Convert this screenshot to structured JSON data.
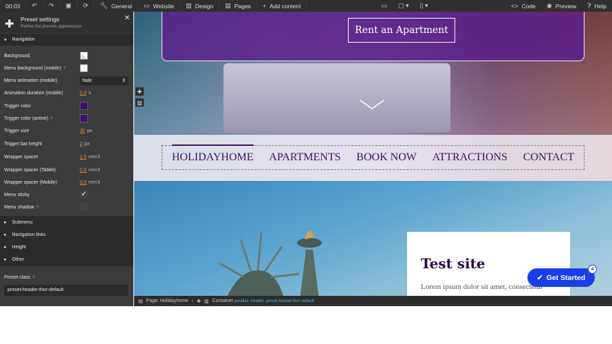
{
  "toolbar": {
    "time": "00:03",
    "general": "General",
    "website": "Website",
    "design": "Design",
    "pages": "Pages",
    "add_content": "Add content",
    "code": "Code",
    "preview": "Preview",
    "help": "Help"
  },
  "panel": {
    "title": "Preset settings",
    "subtitle": "Refine the presets appearance",
    "section": "Navigation",
    "rows": {
      "background": "Background",
      "menu_bg_mobile": "Menu background (mobile)",
      "menu_anim_mobile": "Menu animation (mobile)",
      "menu_anim_value": "fade",
      "anim_duration": "Animation duration (mobile)",
      "anim_duration_value": "0.3",
      "anim_duration_unit": "s",
      "trigger_color": "Trigger color",
      "trigger_color_value": "#3d0e6e",
      "trigger_color_active": "Trigger color (active)",
      "trigger_size": "Trigger size",
      "trigger_size_value": "30",
      "px": "px",
      "trigger_bar_height": "Trigger bar height",
      "trigger_bar_height_value": "2",
      "wrapper_spacer": "Wrapper spacer",
      "wrapper_spacer_value": "1.5",
      "rem": "rem",
      "wrapper_spacer_tablet": "Wrapper spacer (Tablet)",
      "wrapper_spacer_tablet_value": "0.5",
      "wrapper_spacer_mobile": "Wrapper spacer (Mobile)",
      "wrapper_spacer_mobile_value": "0.5",
      "menu_sticky": "Menu sticky",
      "menu_sticky_checked": true,
      "menu_shadow": "Menu shadow",
      "menu_shadow_checked": false
    },
    "collapsed": [
      "Submenu",
      "Navigation links",
      "Height",
      "Other"
    ],
    "preset_class_label": "Preset class",
    "preset_class_value": "preset-header-thor-default"
  },
  "site": {
    "cta": "Rent an Apartment",
    "nav": [
      "HOLIDAYHOME",
      "APARTMENTS",
      "BOOK NOW",
      "ATTRACTIONS",
      "CONTACT"
    ],
    "card_title": "Test site",
    "card_text": "Lorem ipsum dolor sit amet, consectetur",
    "get_started": "Get Started",
    "badge": "4"
  },
  "status": {
    "page": "Page: Holidayhome",
    "container": "Container",
    "classes": ".parallax .header .preset-header-thor-default"
  },
  "colors": {
    "accent": "#3a1560",
    "get_started": "#1a3ee8",
    "value": "#e8913c"
  }
}
